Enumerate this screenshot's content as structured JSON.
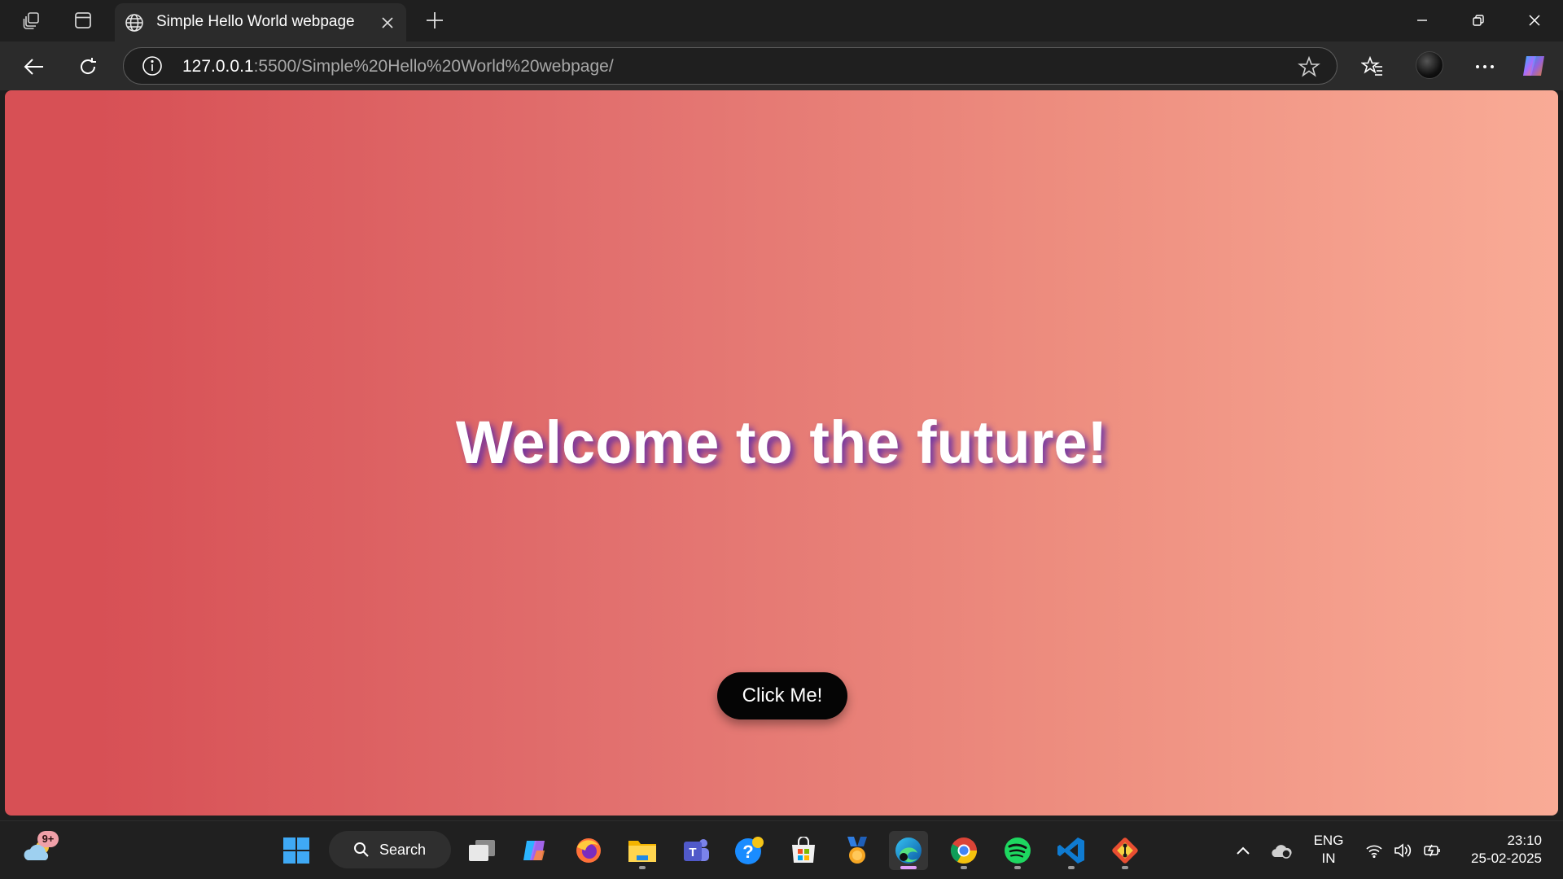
{
  "browser": {
    "tab": {
      "title": "Simple Hello World webpage"
    },
    "address_bar": {
      "host": "127.0.0.1",
      "path": ":5500/Simple%20Hello%20World%20webpage/"
    }
  },
  "page": {
    "headline": "Welcome to the future!",
    "button_label": "Click Me!",
    "gradient_colors": [
      "#d75055",
      "#e2716f",
      "#ee8f80",
      "#f9ab96"
    ],
    "headline_shadow_color": "#5a28aa"
  },
  "taskbar": {
    "search_label": "Search",
    "weather_badge": "9+",
    "apps": [
      "start",
      "search",
      "task-view",
      "copilot",
      "firefox",
      "file-explorer",
      "teams",
      "get-help",
      "microsoft-store",
      "medal",
      "edge",
      "chrome",
      "spotify",
      "vscode",
      "git"
    ],
    "language": {
      "line1": "ENG",
      "line2": "IN"
    },
    "clock": {
      "time": "23:10",
      "date": "25-02-2025"
    }
  },
  "colors": {
    "titlebar": "#1f1f1f",
    "toolbar": "#2b2b2b",
    "taskbar": "#202020",
    "button_bg": "#050505"
  }
}
